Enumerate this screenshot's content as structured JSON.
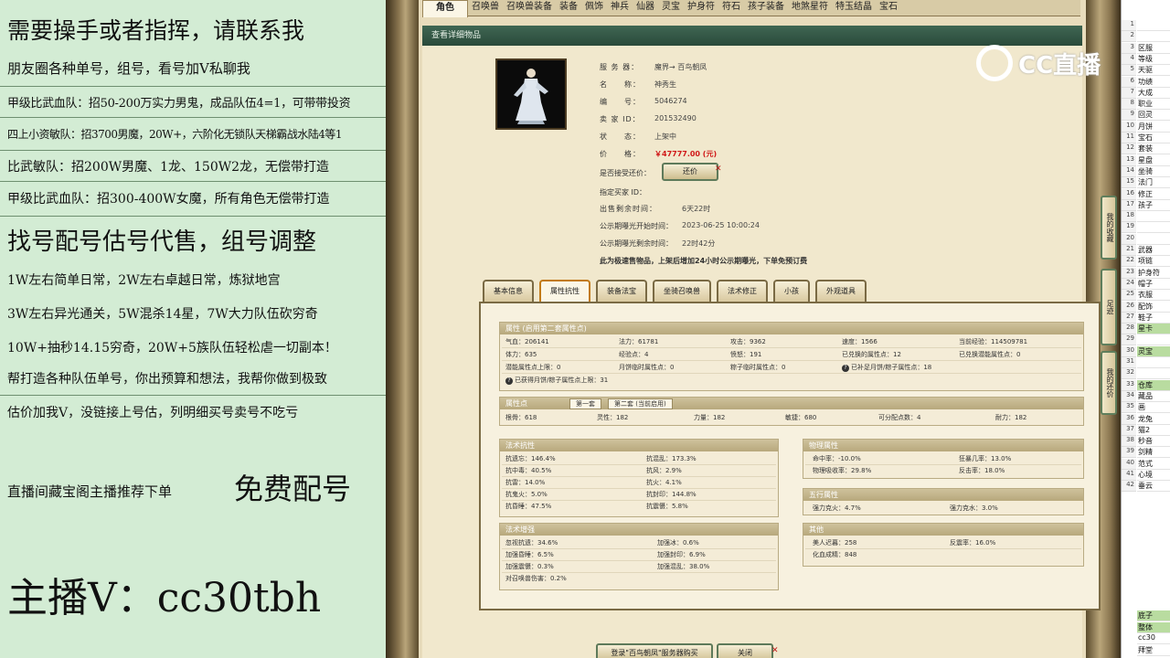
{
  "promo": {
    "lines": [
      "需要操手或者指挥，请联系我",
      "朋友圈各种单号，组号，看号加V私聊我",
      "甲级比武血队：招50-200万实力男鬼，成品队伍4=1，可带带投资",
      "四上小资敏队：招3700男魔，20W+，六阶化无锁队天梯霸战水陆4等1",
      "比武敏队：招200W男魔、1龙、150W2龙，无偿带打造",
      "甲级比武血队：招300-400W女魔，所有角色无偿带打造",
      "找号配号估号代售，组号调整",
      "1W左右简单日常，2W左右卓越日常，炼狱地宫",
      "3W左右异光通关，5W混杀14星，7W大力队伍砍穷奇",
      "10W+抽秒14.15穷奇，20W+5族队伍轻松虐一切副本！",
      "帮打造各种队伍单号，你出预算和想法，我帮你做到极致",
      "估价加我V，没链接上号估，列明细买号卖号不吃亏",
      "直播间藏宝阁主播推荐下单",
      "免费配号",
      "主播V：cc30tbh"
    ]
  },
  "game": {
    "tabs": [
      "角色",
      "召唤兽",
      "召唤兽装备",
      "装备",
      "佩饰",
      "神兵",
      "仙器",
      "灵宝",
      "护身符",
      "符石",
      "孩子装备",
      "地煞星符",
      "特玉结晶",
      "宝石"
    ],
    "title": "查看详细物品",
    "info": [
      {
        "k": "服 务 器：",
        "v": "魔界→ 百鸟朝凤"
      },
      {
        "k": "名　　称：",
        "v": "神秀生"
      },
      {
        "k": "编　　号：",
        "v": "5046274"
      },
      {
        "k": "卖 家 ID：",
        "v": "201532490"
      },
      {
        "k": "状　　态：",
        "v": "上架中"
      },
      {
        "k": "价　　格：",
        "v": "￥47777.00 (元)"
      }
    ],
    "bargain_label": "是否接受还价：",
    "bargain_btn": "还价",
    "designated_buyer": "指定买家 ID：",
    "timings": [
      {
        "k": "出售剩余时间：",
        "v": "6天22时"
      },
      {
        "k": "公示期曝光开始时间：",
        "v": "2023-06-25 10:00:24"
      },
      {
        "k": "公示期曝光剩余时间：",
        "v": "22时42分"
      }
    ],
    "notice": "此为极速售物品，上架后增加24小时公示期曝光，下单免预订费",
    "detail_tabs": [
      "基本信息",
      "属性抗性",
      "装备法宝",
      "坐骑召唤兽",
      "法术修正",
      "小孩",
      "外观道具"
    ],
    "attr_header": "属性 (启用第二套属性点)",
    "attr_rows": [
      [
        "气血：206141",
        "法力：61781",
        "攻击：9362",
        "速度：1566",
        "当前经验：114509781"
      ],
      [
        "体力：635",
        "经验点：4",
        "愤怒：191",
        "已兑换的属性点：12",
        "已兑换潜能属性点：0"
      ],
      [
        "潜能属性点上限：0",
        "月饼临时属性点：0",
        "粽子临时属性点：0",
        "已补足月饼/粽子属性点：18",
        ""
      ],
      [
        "已获得月饼/粽子属性点上限：31",
        "",
        "",
        "",
        ""
      ]
    ],
    "points_header": "属性点",
    "points_tabs": [
      "第一套",
      "第二套 (当前启用)"
    ],
    "points": [
      "根骨：618",
      "灵性：182",
      "力量：182",
      "敏捷：680",
      "可分配点数：4",
      "耐力：182"
    ],
    "resist_header": "法术抗性",
    "resist": [
      [
        "抗遗忘：146.4%",
        "抗混乱：173.3%"
      ],
      [
        "抗中毒：40.5%",
        "抗风：2.9%"
      ],
      [
        "抗雷：14.0%",
        "抗火：4.1%"
      ],
      [
        "抗鬼火：5.0%",
        "抗封印：144.8%"
      ],
      [
        "抗昏睡：47.5%",
        "抗震慑：5.8%"
      ]
    ],
    "enhance_header": "法术增强",
    "enhance": [
      [
        "忽视抗遗：34.6%",
        "加强冰：0.6%"
      ],
      [
        "加强昏睡：6.5%",
        "加强封印：6.9%"
      ],
      [
        "加强震慑：0.3%",
        "加强混乱：38.0%"
      ],
      [
        "对召唤兽伤害：0.2%",
        ""
      ]
    ],
    "phys_header": "物理属性",
    "phys": [
      [
        "命中率：-10.0%",
        "狂暴几率：13.0%"
      ],
      [
        "物理吸收率：29.8%",
        "反击率：18.0%"
      ]
    ],
    "five_header": "五行属性",
    "five": [
      [
        "强力克火：4.7%",
        "强力克水：3.0%"
      ]
    ],
    "other_header": "其他",
    "other": [
      [
        "美人迟暮：258",
        "反震率：16.0%"
      ],
      [
        "化血成精：848",
        ""
      ]
    ],
    "bottom_btns": [
      "登录\"百鸟朝凤\"服务器购买",
      "关闭"
    ],
    "side_btns": [
      "我的收藏",
      "足迹",
      "我的还价"
    ]
  },
  "watermark": "CC直播",
  "sheet": {
    "rows": [
      {
        "n": "1",
        "c": ""
      },
      {
        "n": "2",
        "c": ""
      },
      {
        "n": "3",
        "c": "区服"
      },
      {
        "n": "4",
        "c": "等级"
      },
      {
        "n": "5",
        "c": "天驱"
      },
      {
        "n": "6",
        "c": "功绩"
      },
      {
        "n": "7",
        "c": "大成"
      },
      {
        "n": "8",
        "c": "职业"
      },
      {
        "n": "9",
        "c": "回灵"
      },
      {
        "n": "10",
        "c": "月饼"
      },
      {
        "n": "11",
        "c": "宝石"
      },
      {
        "n": "12",
        "c": "套装"
      },
      {
        "n": "13",
        "c": "星盘"
      },
      {
        "n": "14",
        "c": "坐骑"
      },
      {
        "n": "15",
        "c": "法门"
      },
      {
        "n": "16",
        "c": "修正"
      },
      {
        "n": "17",
        "c": "孩子"
      },
      {
        "n": "18",
        "c": ""
      },
      {
        "n": "19",
        "c": ""
      },
      {
        "n": "20",
        "c": ""
      },
      {
        "n": "21",
        "c": "武器"
      },
      {
        "n": "22",
        "c": "项链"
      },
      {
        "n": "23",
        "c": "护身符"
      },
      {
        "n": "24",
        "c": "帽子"
      },
      {
        "n": "25",
        "c": "衣服"
      },
      {
        "n": "26",
        "c": "配饰"
      },
      {
        "n": "27",
        "c": "鞋子"
      },
      {
        "n": "28",
        "c": "星卡"
      },
      {
        "n": "29",
        "c": ""
      },
      {
        "n": "30",
        "c": "灵宝"
      },
      {
        "n": "31",
        "c": ""
      },
      {
        "n": "32",
        "c": ""
      },
      {
        "n": "33",
        "c": "仓库"
      },
      {
        "n": "34",
        "c": "藏品"
      },
      {
        "n": "35",
        "c": "画"
      },
      {
        "n": "36",
        "c": "龙兔"
      },
      {
        "n": "37",
        "c": "猫2"
      },
      {
        "n": "38",
        "c": "秒音"
      },
      {
        "n": "39",
        "c": "剑精"
      },
      {
        "n": "40",
        "c": "范式"
      },
      {
        "n": "41",
        "c": "心境"
      },
      {
        "n": "42",
        "c": "垂云"
      }
    ],
    "bottom": [
      {
        "n": "",
        "c": "底子"
      },
      {
        "n": "",
        "c": "整体"
      },
      {
        "n": "",
        "c": "cc30"
      },
      {
        "n": "",
        "c": "拜堂"
      }
    ]
  }
}
